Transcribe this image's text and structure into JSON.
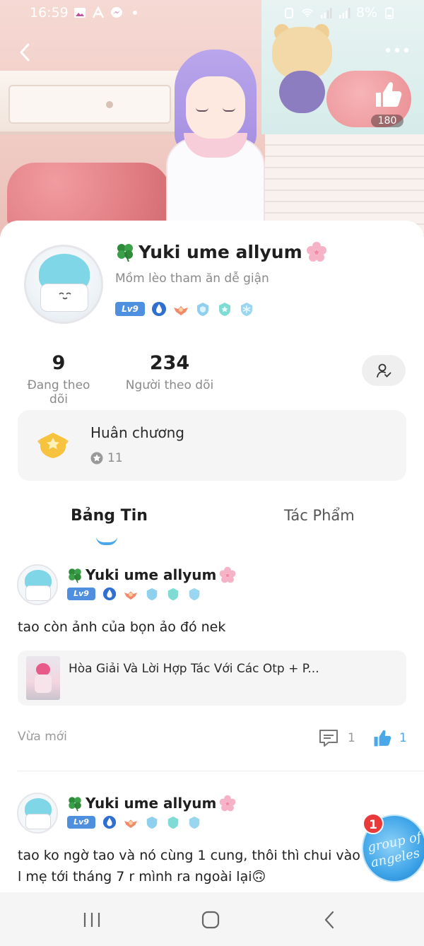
{
  "status_bar": {
    "time": "16:59",
    "battery": "8%"
  },
  "header": {
    "like_count": "180"
  },
  "profile": {
    "name": "Yuki ume allyum",
    "bio": "Mồm lèo tham ăn dễ giận",
    "level": "Lv9"
  },
  "stats": {
    "following_count": "9",
    "following_label": "Đang theo dõi",
    "followers_count": "234",
    "followers_label": "Người theo dõi"
  },
  "medals": {
    "title": "Huân chương",
    "count": "11"
  },
  "tabs": [
    {
      "label": "Bảng Tin",
      "active": true
    },
    {
      "label": "Tác Phẩm",
      "active": false
    }
  ],
  "posts": [
    {
      "author": "Yuki ume allyum",
      "level": "Lv9",
      "text": "tao còn ảnh của bọn ảo đó nek",
      "shared_title": "Hòa Giải Và Lời Hợp Tác Với Các Otp + P...",
      "time": "Vừa mới",
      "comments": "1",
      "likes": "1"
    },
    {
      "author": "Yuki ume allyum",
      "level": "Lv9",
      "text": "tao ko ngờ tao và nó cùng 1 cung, thôi thì chui vào l mẹ tới tháng 7 r mình ra ngoài lại🙃"
    }
  ],
  "floating_button": {
    "badge": "1",
    "text": "group of angeles"
  },
  "colors": {
    "accent": "#4aa8e8",
    "level_badge": "#4f8fe0",
    "notification": "#e83a3a"
  },
  "icons": {
    "back": "chevron-left-icon",
    "more": "more-dots-icon",
    "like": "thumbs-up-icon",
    "follow": "person-check-icon",
    "comment": "comment-icon",
    "medal": "gold-medal-icon"
  }
}
